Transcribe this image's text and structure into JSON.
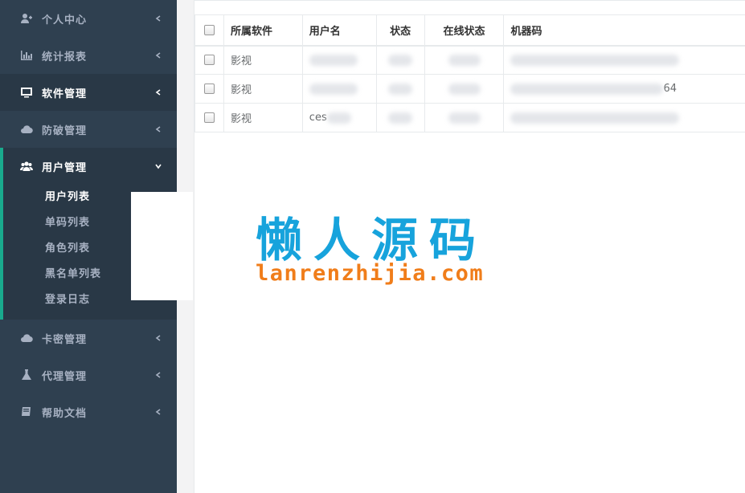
{
  "sidebar": {
    "items": [
      {
        "label": "个人中心",
        "icon": "user-plus-icon"
      },
      {
        "label": "统计报表",
        "icon": "bar-chart-icon"
      },
      {
        "label": "软件管理",
        "icon": "monitor-icon"
      },
      {
        "label": "防破管理",
        "icon": "cloud-upload-icon"
      },
      {
        "label": "用户管理",
        "icon": "users-icon"
      },
      {
        "label": "卡密管理",
        "icon": "cloud-chart-icon"
      },
      {
        "label": "代理管理",
        "icon": "flask-icon"
      },
      {
        "label": "帮助文档",
        "icon": "book-icon"
      }
    ],
    "user_sub": [
      "用户列表",
      "单码列表",
      "角色列表",
      "黑名单列表",
      "登录日志"
    ]
  },
  "table": {
    "headers": [
      "所属软件",
      "用户名",
      "状态",
      "在线状态",
      "机器码"
    ],
    "rows": [
      {
        "software": "影视",
        "username": "",
        "status": "",
        "online": "",
        "machine": ""
      },
      {
        "software": "影视",
        "username": "",
        "status": "",
        "online": "",
        "machine": "64"
      },
      {
        "software": "影视",
        "username": "ces",
        "status": "",
        "online": "",
        "machine": ""
      }
    ]
  },
  "watermark": {
    "title": "懒人源码",
    "url": "lanrenzhijia.com"
  },
  "colors": {
    "sidebar_bg": "#2f4050",
    "sidebar_active_bg": "#293846",
    "accent": "#19aa8d",
    "watermark_blue": "#17a3dc",
    "watermark_orange": "#f07d1a"
  }
}
